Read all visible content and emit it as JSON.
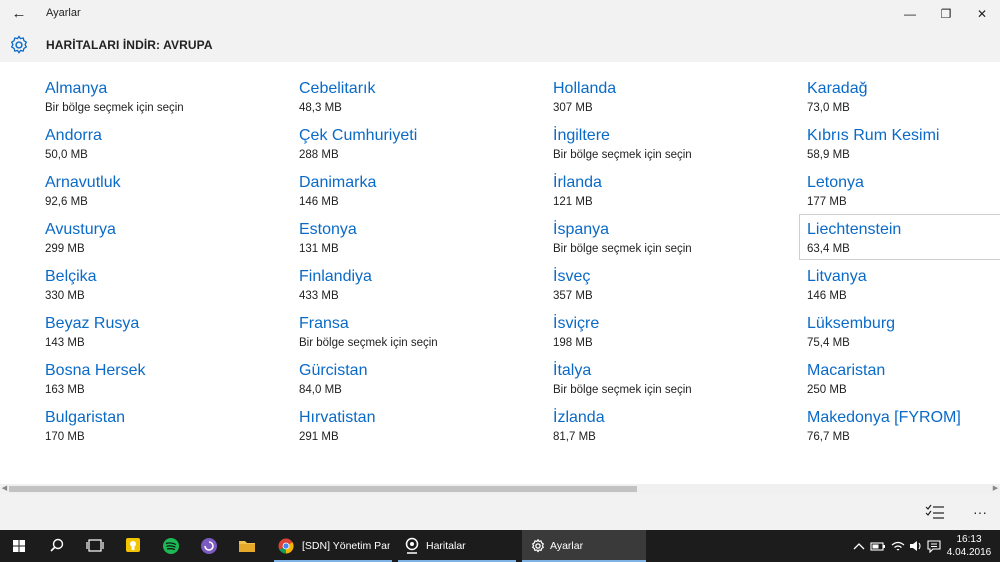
{
  "window": {
    "title": "Ayarlar",
    "minimize": "—",
    "restore": "❐",
    "close": "✕",
    "back": "←"
  },
  "header": {
    "title": "HARİTALARI İNDİR: AVRUPA",
    "icon": "gear-icon"
  },
  "countries": [
    {
      "name": "Almanya",
      "sub": "Bir bölge seçmek için seçin"
    },
    {
      "name": "Andorra",
      "sub": "50,0 MB"
    },
    {
      "name": "Arnavutluk",
      "sub": "92,6 MB"
    },
    {
      "name": "Avusturya",
      "sub": "299 MB"
    },
    {
      "name": "Belçika",
      "sub": "330 MB"
    },
    {
      "name": "Beyaz Rusya",
      "sub": "143 MB"
    },
    {
      "name": "Bosna Hersek",
      "sub": "163 MB"
    },
    {
      "name": "Bulgaristan",
      "sub": "170 MB"
    },
    {
      "name": "Cebelitarık",
      "sub": "48,3 MB"
    },
    {
      "name": "Çek Cumhuriyeti",
      "sub": "288 MB"
    },
    {
      "name": "Danimarka",
      "sub": "146 MB"
    },
    {
      "name": "Estonya",
      "sub": "131 MB"
    },
    {
      "name": "Finlandiya",
      "sub": "433 MB"
    },
    {
      "name": "Fransa",
      "sub": "Bir bölge seçmek için seçin"
    },
    {
      "name": "Gürcistan",
      "sub": "84,0 MB"
    },
    {
      "name": "Hırvatistan",
      "sub": "291 MB"
    },
    {
      "name": "Hollanda",
      "sub": "307 MB"
    },
    {
      "name": "İngiltere",
      "sub": "Bir bölge seçmek için seçin"
    },
    {
      "name": "İrlanda",
      "sub": "121 MB"
    },
    {
      "name": "İspanya",
      "sub": "Bir bölge seçmek için seçin"
    },
    {
      "name": "İsveç",
      "sub": "357 MB"
    },
    {
      "name": "İsviçre",
      "sub": "198 MB"
    },
    {
      "name": "İtalya",
      "sub": "Bir bölge seçmek için seçin"
    },
    {
      "name": "İzlanda",
      "sub": "81,7 MB"
    },
    {
      "name": "Karadağ",
      "sub": "73,0 MB"
    },
    {
      "name": "Kıbrıs Rum Kesimi",
      "sub": "58,9 MB"
    },
    {
      "name": "Letonya",
      "sub": "177 MB"
    },
    {
      "name": "Liechtenstein",
      "sub": "63,4 MB"
    },
    {
      "name": "Litvanya",
      "sub": "146 MB"
    },
    {
      "name": "Lüksemburg",
      "sub": "75,4 MB"
    },
    {
      "name": "Macaristan",
      "sub": "250 MB"
    },
    {
      "name": "Makedonya [FYROM]",
      "sub": "76,7 MB"
    }
  ],
  "appbar": {
    "select_icon": "multi-select-icon",
    "more": "···"
  },
  "taskbar": {
    "apps": [
      {
        "label": "[SDN] Yönetim Pane...",
        "icon": "chrome-icon"
      },
      {
        "label": "Haritalar",
        "icon": "maps-icon"
      },
      {
        "label": "Ayarlar",
        "icon": "settings-icon"
      }
    ],
    "time": "16:13",
    "date": "4.04.2016"
  },
  "colors": {
    "link": "#0a6ac7",
    "chrome_bg": "#f2f2f2",
    "taskbar_bg": "#1c1c1c"
  }
}
